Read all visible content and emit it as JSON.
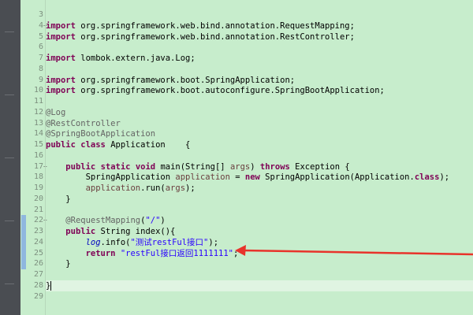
{
  "editor": {
    "lines": [
      {
        "number": "3",
        "tokens": []
      },
      {
        "number": "4",
        "fold": "−",
        "tokens": [
          {
            "t": "import",
            "c": "kw"
          },
          {
            "t": " org.springframework.web.bind.annotation.RequestMapping;",
            "c": ""
          }
        ]
      },
      {
        "number": "5",
        "tokens": [
          {
            "t": "import",
            "c": "kw"
          },
          {
            "t": " org.springframework.web.bind.annotation.RestController;",
            "c": ""
          }
        ]
      },
      {
        "number": "6",
        "tokens": []
      },
      {
        "number": "7",
        "tokens": [
          {
            "t": "import",
            "c": "kw"
          },
          {
            "t": " lombok.extern.java.Log;",
            "c": ""
          }
        ]
      },
      {
        "number": "8",
        "tokens": []
      },
      {
        "number": "9",
        "tokens": [
          {
            "t": "import",
            "c": "kw"
          },
          {
            "t": " org.springframework.boot.SpringApplication;",
            "c": ""
          }
        ]
      },
      {
        "number": "10",
        "tokens": [
          {
            "t": "import",
            "c": "kw"
          },
          {
            "t": " org.springframework.boot.autoconfigure.SpringBootApplication;",
            "c": ""
          }
        ]
      },
      {
        "number": "11",
        "tokens": []
      },
      {
        "number": "12",
        "tokens": [
          {
            "t": "@Log",
            "c": "ann"
          }
        ]
      },
      {
        "number": "13",
        "tokens": [
          {
            "t": "@RestController",
            "c": "ann"
          }
        ]
      },
      {
        "number": "14",
        "tokens": [
          {
            "t": "@SpringBootApplication",
            "c": "ann"
          }
        ]
      },
      {
        "number": "15",
        "tokens": [
          {
            "t": "public",
            "c": "kw"
          },
          {
            "t": " ",
            "c": ""
          },
          {
            "t": "class",
            "c": "kw"
          },
          {
            "t": " Application    {",
            "c": ""
          }
        ]
      },
      {
        "number": "16",
        "tokens": []
      },
      {
        "number": "17",
        "fold": "−",
        "tokens": [
          {
            "t": "    ",
            "c": ""
          },
          {
            "t": "public",
            "c": "kw"
          },
          {
            "t": " ",
            "c": ""
          },
          {
            "t": "static",
            "c": "kw"
          },
          {
            "t": " ",
            "c": ""
          },
          {
            "t": "void",
            "c": "kw"
          },
          {
            "t": " main(String[] ",
            "c": ""
          },
          {
            "t": "args",
            "c": "loc"
          },
          {
            "t": ") ",
            "c": ""
          },
          {
            "t": "throws",
            "c": "kw"
          },
          {
            "t": " Exception {",
            "c": ""
          }
        ]
      },
      {
        "number": "18",
        "tokens": [
          {
            "t": "        SpringApplication ",
            "c": ""
          },
          {
            "t": "application",
            "c": "loc"
          },
          {
            "t": " = ",
            "c": ""
          },
          {
            "t": "new",
            "c": "kw"
          },
          {
            "t": " SpringApplication(Application.",
            "c": ""
          },
          {
            "t": "class",
            "c": "kw"
          },
          {
            "t": ");",
            "c": ""
          }
        ]
      },
      {
        "number": "19",
        "tokens": [
          {
            "t": "        ",
            "c": ""
          },
          {
            "t": "application",
            "c": "loc"
          },
          {
            "t": ".run(",
            "c": ""
          },
          {
            "t": "args",
            "c": "loc"
          },
          {
            "t": ");",
            "c": ""
          }
        ]
      },
      {
        "number": "20",
        "tokens": [
          {
            "t": "    }",
            "c": ""
          }
        ]
      },
      {
        "number": "21",
        "tokens": []
      },
      {
        "number": "22",
        "fold": "−",
        "changed": true,
        "tokens": [
          {
            "t": "    ",
            "c": ""
          },
          {
            "t": "@RequestMapping",
            "c": "ann"
          },
          {
            "t": "(",
            "c": ""
          },
          {
            "t": "\"/\"",
            "c": "str"
          },
          {
            "t": ")",
            "c": ""
          }
        ]
      },
      {
        "number": "23",
        "changed": true,
        "tokens": [
          {
            "t": "    ",
            "c": ""
          },
          {
            "t": "public",
            "c": "kw"
          },
          {
            "t": " String index(){",
            "c": ""
          }
        ]
      },
      {
        "number": "24",
        "changed": true,
        "tokens": [
          {
            "t": "        ",
            "c": ""
          },
          {
            "t": "log",
            "c": "stat"
          },
          {
            "t": ".info(",
            "c": ""
          },
          {
            "t": "\"测试restFul接口\"",
            "c": "str"
          },
          {
            "t": ");",
            "c": ""
          }
        ]
      },
      {
        "number": "25",
        "changed": true,
        "tokens": [
          {
            "t": "        ",
            "c": ""
          },
          {
            "t": "return",
            "c": "kw"
          },
          {
            "t": " ",
            "c": ""
          },
          {
            "t": "\"restFul接口返回1111111\"",
            "c": "str"
          },
          {
            "t": ";",
            "c": ""
          }
        ]
      },
      {
        "number": "26",
        "changed": true,
        "tokens": [
          {
            "t": "    }",
            "c": ""
          }
        ]
      },
      {
        "number": "27",
        "tokens": []
      },
      {
        "number": "28",
        "current": true,
        "tokens": [
          {
            "t": "}",
            "c": ""
          }
        ]
      },
      {
        "number": "29",
        "tokens": []
      }
    ]
  },
  "annotation": {
    "arrow_color": "#e8332b"
  }
}
